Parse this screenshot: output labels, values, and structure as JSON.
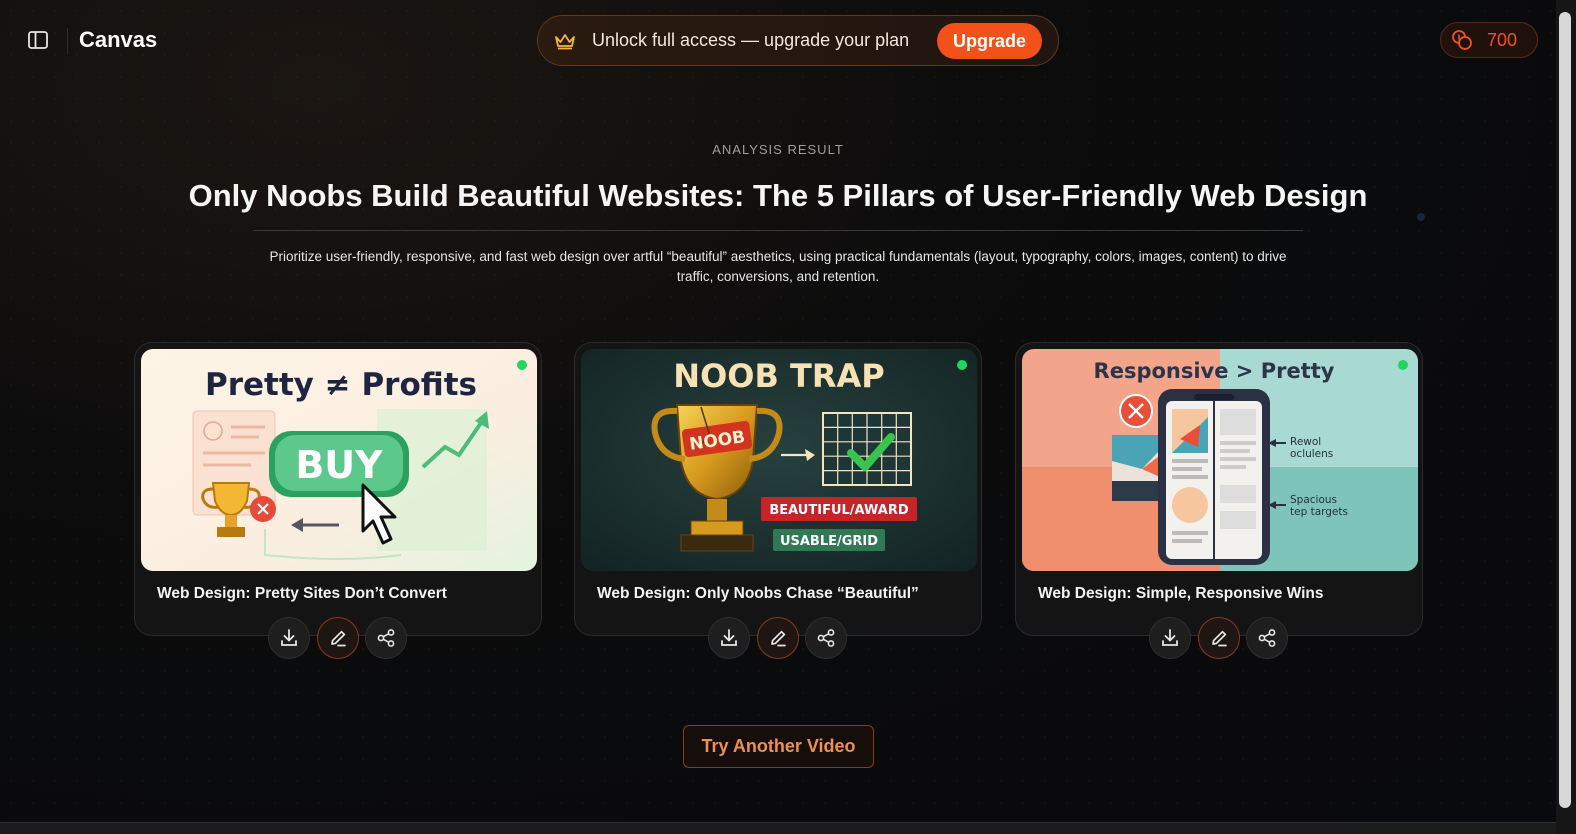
{
  "header": {
    "app_title": "Canvas",
    "banner_text": "Unlock full access — upgrade your plan",
    "upgrade_label": "Upgrade",
    "credits": "700",
    "accent_color": "#f2521a"
  },
  "result": {
    "eyebrow": "ANALYSIS RESULT",
    "title": "Only Noobs Build Beautiful Websites: The 5 Pillars of User-Friendly Web Design",
    "summary": "Prioritize user-friendly, responsive, and fast web design over artful “beautiful” aesthetics, using practical fundamentals (layout, typography, colors, images, content) to drive traffic, conversions, and retention."
  },
  "cards": [
    {
      "title": "Web Design: Pretty Sites Don’t Convert",
      "image_heading": "Pretty ≠ Profits",
      "image_button": "BUY",
      "status": "ready"
    },
    {
      "title": "Web Design: Only Noobs Chase “Beautiful”",
      "image_heading": "NOOB TRAP",
      "trophy_label": "NOOB",
      "tag_bad": "BEAUTIFUL/AWARD",
      "tag_good": "USABLE/GRID",
      "status": "ready"
    },
    {
      "title": "Web Design: Simple, Responsive Wins",
      "image_heading": "Responsive > Pretty",
      "callout_1_line1": "Rewol",
      "callout_1_line2": "oclulens",
      "callout_2_line1": "Spacious",
      "callout_2_line2": "tep targets",
      "status": "ready"
    }
  ],
  "actions": {
    "download_icon": "download-icon",
    "edit_icon": "pencil-icon",
    "share_icon": "share-icon"
  },
  "footer": {
    "try_label": "Try Another Video"
  }
}
